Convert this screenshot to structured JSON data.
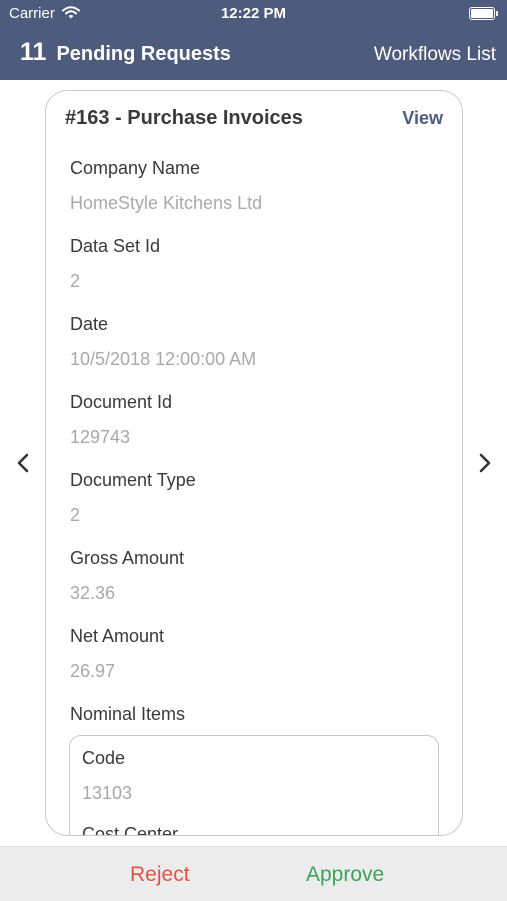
{
  "status_bar": {
    "carrier": "Carrier",
    "time": "12:22 PM"
  },
  "nav": {
    "count": "11",
    "title": "Pending Requests",
    "workflows_link": "Workflows List"
  },
  "card": {
    "title": "#163 - Purchase Invoices",
    "view_label": "View",
    "fields": [
      {
        "label": "Company Name",
        "value": "HomeStyle Kitchens Ltd"
      },
      {
        "label": "Data Set Id",
        "value": "2"
      },
      {
        "label": "Date",
        "value": "10/5/2018 12:00:00 AM"
      },
      {
        "label": "Document Id",
        "value": "129743"
      },
      {
        "label": "Document Type",
        "value": "2"
      },
      {
        "label": "Gross Amount",
        "value": "32.36"
      },
      {
        "label": "Net Amount",
        "value": "26.97"
      }
    ],
    "nominal_items_label": "Nominal Items",
    "nominal_items": [
      {
        "label": "Code",
        "value": "13103"
      },
      {
        "label": "Cost Center"
      }
    ]
  },
  "footer": {
    "reject_label": "Reject",
    "approve_label": "Approve"
  },
  "colors": {
    "nav_bg": "#4d5b7c",
    "reject": "#e0533f",
    "approve": "#3aa35c"
  }
}
